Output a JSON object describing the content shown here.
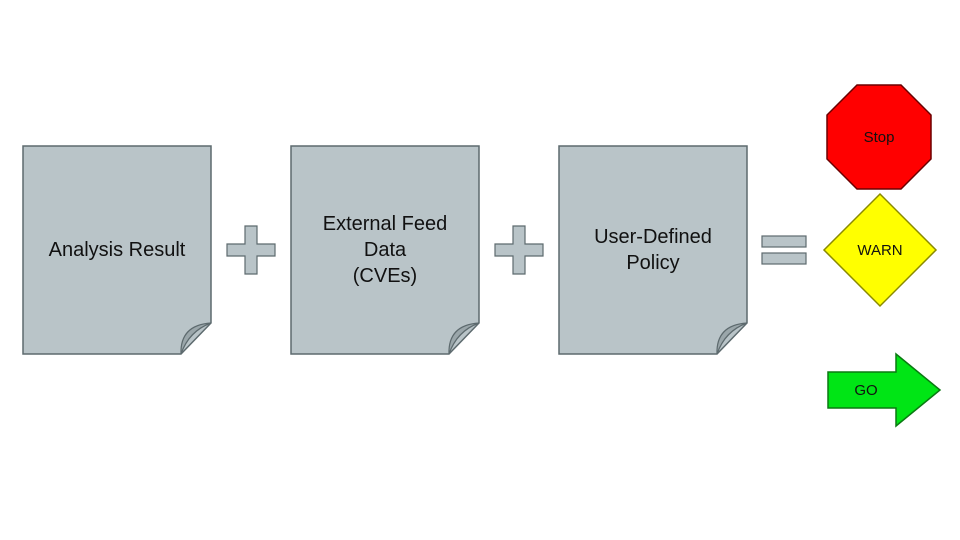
{
  "documents": [
    {
      "label": "Analysis Result"
    },
    {
      "label": "External Feed Data\n(CVEs)"
    },
    {
      "label": "User-Defined Policy"
    }
  ],
  "operators": {
    "plus": "+",
    "equals": "="
  },
  "outcomes": {
    "stop": {
      "label": "Stop",
      "color": "#ff0000"
    },
    "warn": {
      "label": "WARN",
      "color": "#ffff00"
    },
    "go": {
      "label": "GO",
      "color": "#00e515"
    }
  },
  "palette": {
    "docFill": "#b9c4c8",
    "docStroke": "#5d6a6e",
    "opFill": "#b9c4c8"
  }
}
